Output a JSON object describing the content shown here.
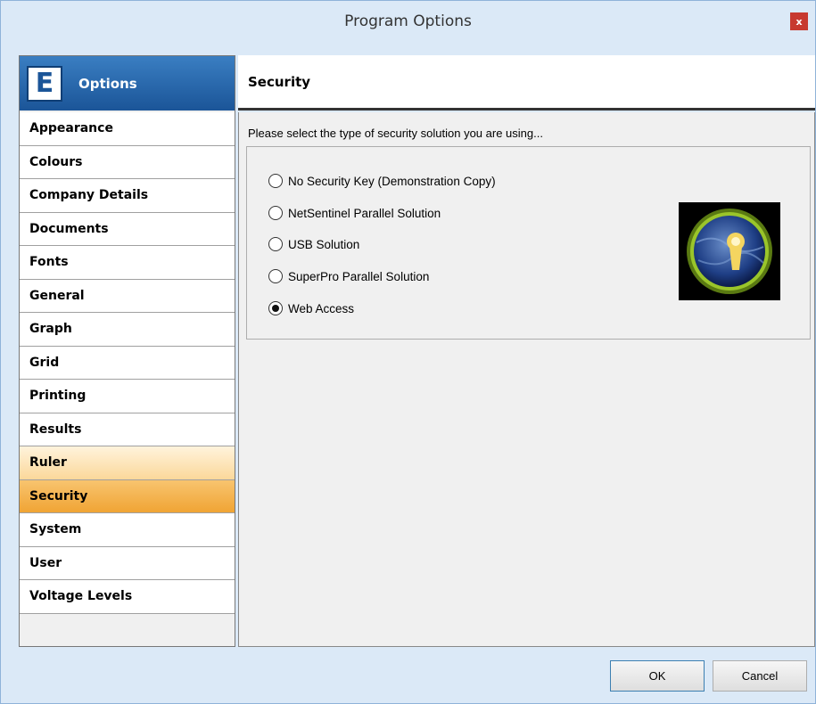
{
  "window": {
    "title": "Program Options",
    "close_label": "x"
  },
  "sidebar": {
    "logo_letter": "E",
    "title": "Options",
    "items": [
      {
        "label": "Appearance"
      },
      {
        "label": "Colours"
      },
      {
        "label": "Company Details"
      },
      {
        "label": "Documents"
      },
      {
        "label": "Fonts"
      },
      {
        "label": "General"
      },
      {
        "label": "Graph"
      },
      {
        "label": "Grid"
      },
      {
        "label": "Printing"
      },
      {
        "label": "Results"
      },
      {
        "label": "Ruler"
      },
      {
        "label": "Security"
      },
      {
        "label": "System"
      },
      {
        "label": "User"
      },
      {
        "label": "Voltage Levels"
      }
    ],
    "selected": "Security"
  },
  "main": {
    "title": "Security",
    "instruction": "Please select the type of security solution you are using...",
    "options": [
      {
        "label": "No Security Key (Demonstration Copy)",
        "checked": false
      },
      {
        "label": "NetSentinel Parallel Solution",
        "checked": false
      },
      {
        "label": "USB Solution",
        "checked": false
      },
      {
        "label": "SuperPro Parallel Solution",
        "checked": false
      },
      {
        "label": "Web Access",
        "checked": true
      }
    ],
    "image_icon": "keyhole-globe-icon"
  },
  "footer": {
    "ok_label": "OK",
    "cancel_label": "Cancel"
  }
}
